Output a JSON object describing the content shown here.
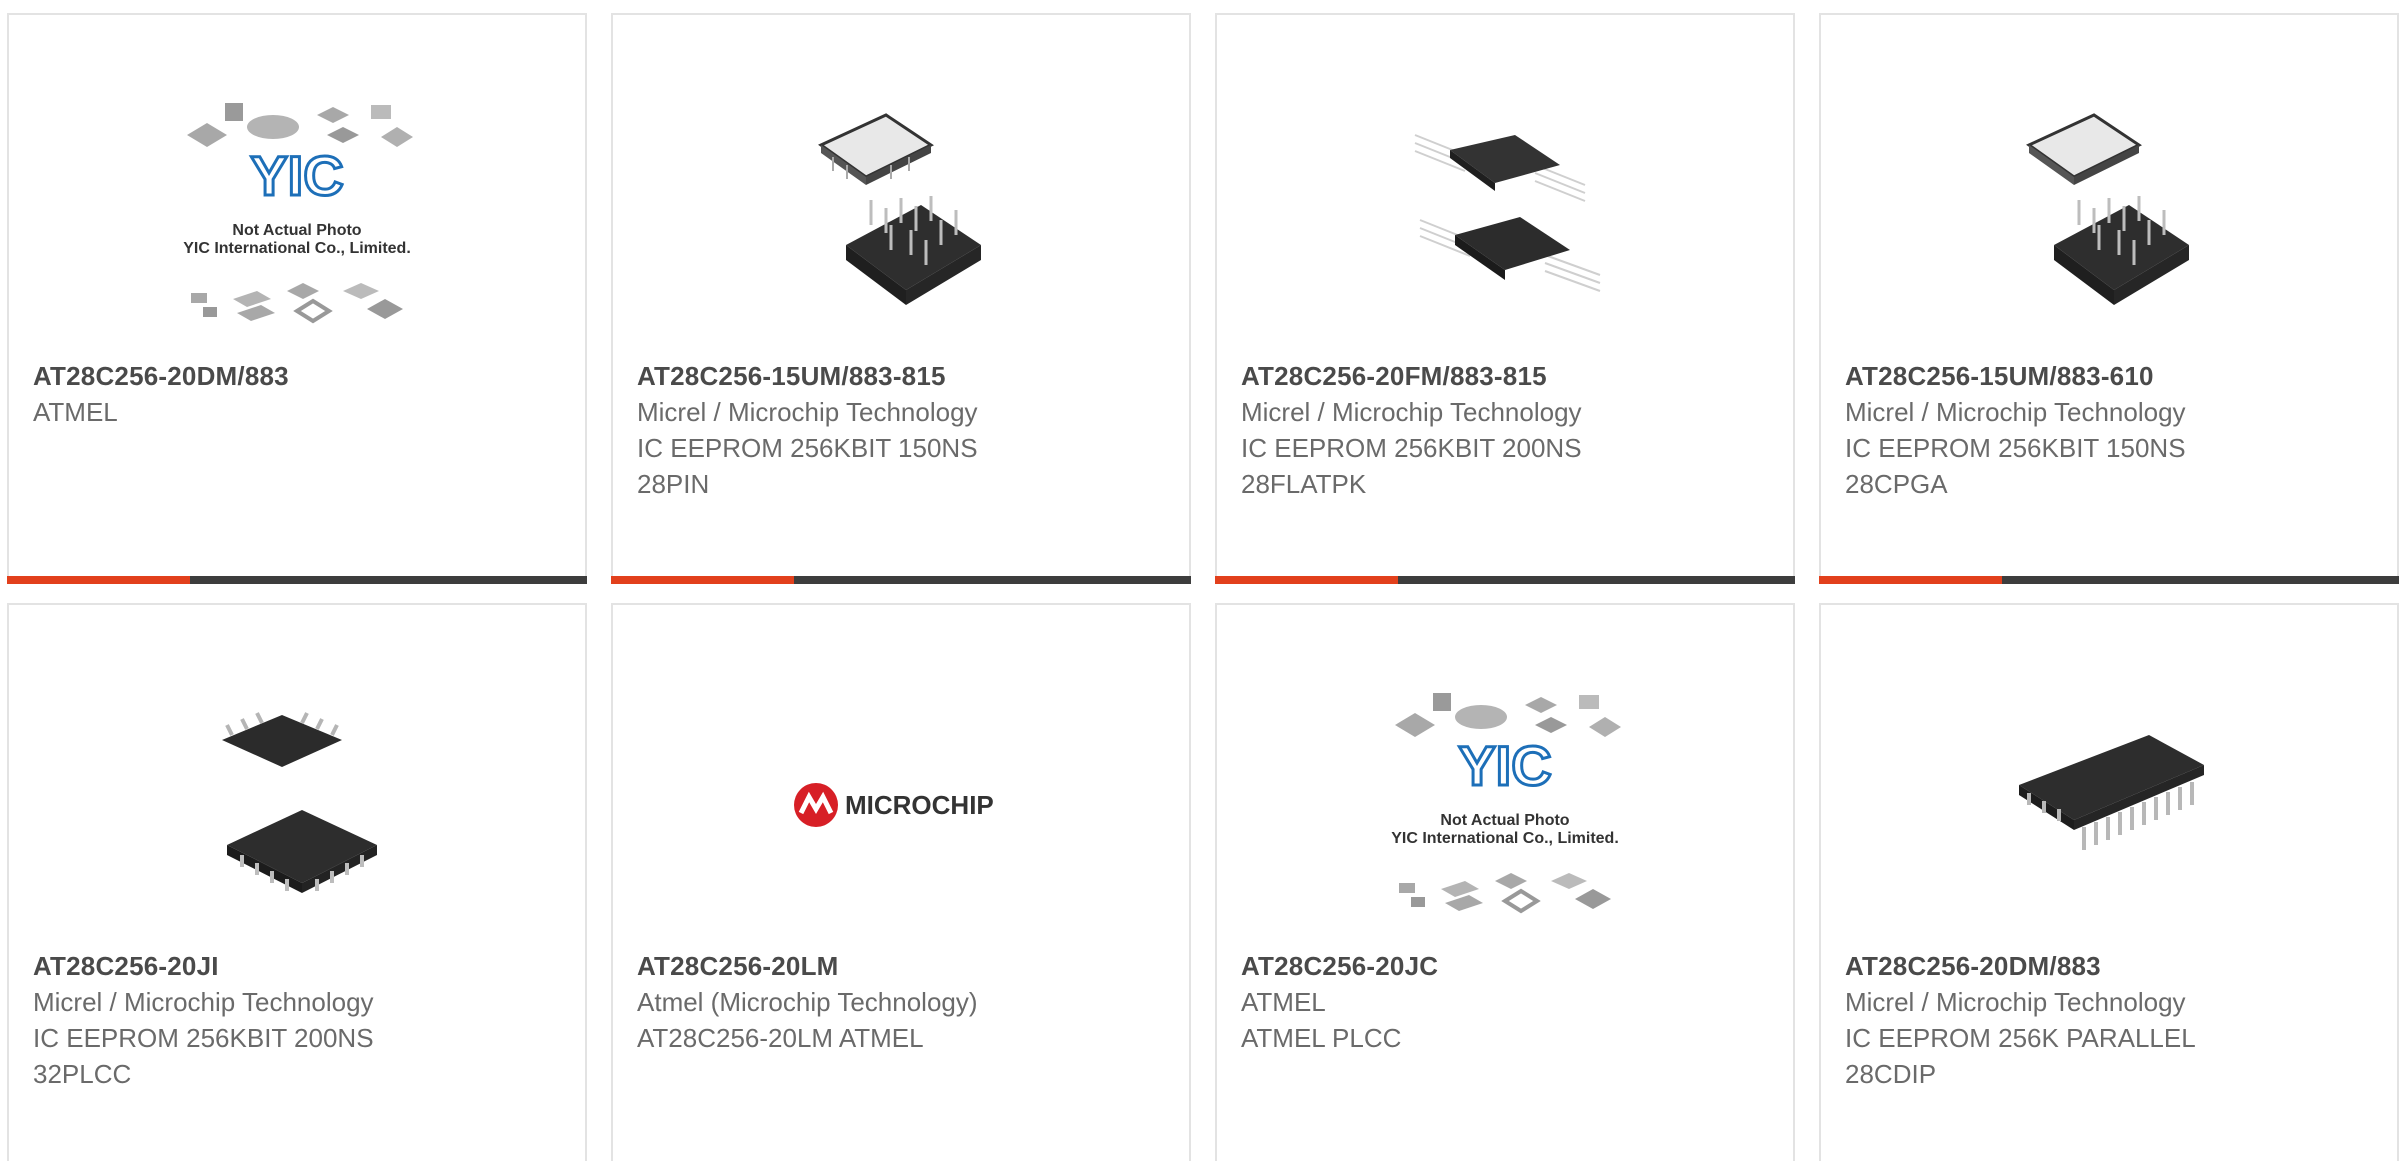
{
  "products": [
    {
      "part_number": "AT28C256-20DM/883",
      "lines": [
        "ATMEL"
      ],
      "image": "placeholder-collage",
      "placeholder_text": [
        "Not Actual Photo",
        "YIC International Co., Limited."
      ],
      "logo_text": "YIC"
    },
    {
      "part_number": "AT28C256-15UM/883-815",
      "lines": [
        "Micrel / Microchip Technology",
        "IC EEPROM 256KBIT 150NS",
        "28PIN"
      ],
      "image": "pga-chip-photo"
    },
    {
      "part_number": "AT28C256-20FM/883-815",
      "lines": [
        "Micrel / Microchip Technology",
        "IC EEPROM 256KBIT 200NS",
        "28FLATPK"
      ],
      "image": "flatpack-chip-photo"
    },
    {
      "part_number": "AT28C256-15UM/883-610",
      "lines": [
        "Micrel / Microchip Technology",
        "IC EEPROM 256KBIT 150NS",
        "28CPGA"
      ],
      "image": "pga-chip-photo"
    },
    {
      "part_number": "AT28C256-20JI",
      "lines": [
        "Micrel / Microchip Technology",
        "IC EEPROM 256KBIT 200NS",
        "32PLCC"
      ],
      "image": "plcc-chip-photo"
    },
    {
      "part_number": "AT28C256-20LM",
      "lines": [
        "Atmel (Microchip Technology)",
        "AT28C256-20LM ATMEL"
      ],
      "image": "microchip-logo",
      "logo_text": "MICROCHIP"
    },
    {
      "part_number": "AT28C256-20JC",
      "lines": [
        "ATMEL",
        "ATMEL PLCC"
      ],
      "image": "placeholder-collage",
      "placeholder_text": [
        "Not Actual Photo",
        "YIC International Co., Limited."
      ],
      "logo_text": "YIC"
    },
    {
      "part_number": "AT28C256-20DM/883",
      "lines": [
        "Micrel / Microchip Technology",
        "IC EEPROM 256K PARALLEL",
        "28CDIP"
      ],
      "image": "dip-chip-photo"
    }
  ],
  "colors": {
    "accent": "#e2401c",
    "bar_dark": "#3d3d3d",
    "border": "#e3e3e3",
    "part_number": "#4a4a4a",
    "detail_text": "#6a6a6a",
    "yic_blue": "#1d6fb8",
    "microchip_red": "#d71f26"
  }
}
